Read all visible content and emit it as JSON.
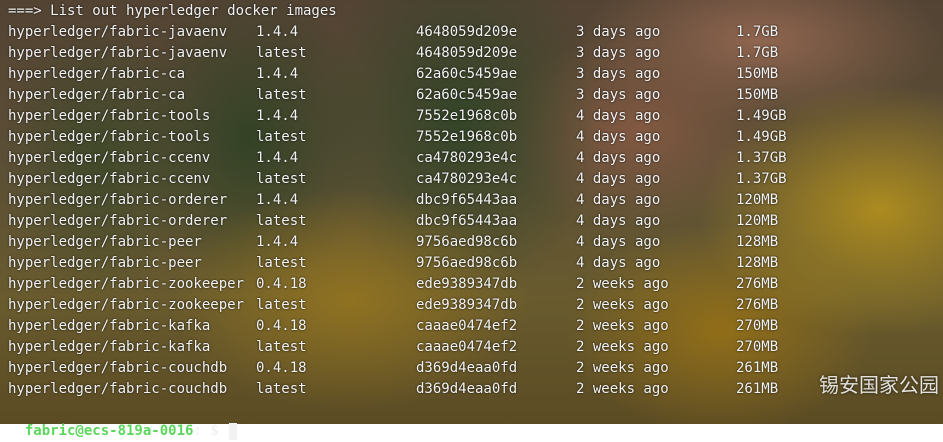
{
  "colors": {
    "prompt_accent": "#5bd75b",
    "text": "#f2f2f2"
  },
  "terminal": {
    "header": "===> List out hyperledger docker images",
    "rows": [
      {
        "repo": "hyperledger/fabric-javaenv",
        "tag": "1.4.4",
        "id": "4648059d209e",
        "created": "3 days ago",
        "size": "1.7GB"
      },
      {
        "repo": "hyperledger/fabric-javaenv",
        "tag": "latest",
        "id": "4648059d209e",
        "created": "3 days ago",
        "size": "1.7GB"
      },
      {
        "repo": "hyperledger/fabric-ca",
        "tag": "1.4.4",
        "id": "62a60c5459ae",
        "created": "3 days ago",
        "size": "150MB"
      },
      {
        "repo": "hyperledger/fabric-ca",
        "tag": "latest",
        "id": "62a60c5459ae",
        "created": "3 days ago",
        "size": "150MB"
      },
      {
        "repo": "hyperledger/fabric-tools",
        "tag": "1.4.4",
        "id": "7552e1968c0b",
        "created": "4 days ago",
        "size": "1.49GB"
      },
      {
        "repo": "hyperledger/fabric-tools",
        "tag": "latest",
        "id": "7552e1968c0b",
        "created": "4 days ago",
        "size": "1.49GB"
      },
      {
        "repo": "hyperledger/fabric-ccenv",
        "tag": "1.4.4",
        "id": "ca4780293e4c",
        "created": "4 days ago",
        "size": "1.37GB"
      },
      {
        "repo": "hyperledger/fabric-ccenv",
        "tag": "latest",
        "id": "ca4780293e4c",
        "created": "4 days ago",
        "size": "1.37GB"
      },
      {
        "repo": "hyperledger/fabric-orderer",
        "tag": "1.4.4",
        "id": "dbc9f65443aa",
        "created": "4 days ago",
        "size": "120MB"
      },
      {
        "repo": "hyperledger/fabric-orderer",
        "tag": "latest",
        "id": "dbc9f65443aa",
        "created": "4 days ago",
        "size": "120MB"
      },
      {
        "repo": "hyperledger/fabric-peer",
        "tag": "1.4.4",
        "id": "9756aed98c6b",
        "created": "4 days ago",
        "size": "128MB"
      },
      {
        "repo": "hyperledger/fabric-peer",
        "tag": "latest",
        "id": "9756aed98c6b",
        "created": "4 days ago",
        "size": "128MB"
      },
      {
        "repo": "hyperledger/fabric-zookeeper",
        "tag": "0.4.18",
        "id": "ede9389347db",
        "created": "2 weeks ago",
        "size": "276MB"
      },
      {
        "repo": "hyperledger/fabric-zookeeper",
        "tag": "latest",
        "id": "ede9389347db",
        "created": "2 weeks ago",
        "size": "276MB"
      },
      {
        "repo": "hyperledger/fabric-kafka",
        "tag": "0.4.18",
        "id": "caaae0474ef2",
        "created": "2 weeks ago",
        "size": "270MB"
      },
      {
        "repo": "hyperledger/fabric-kafka",
        "tag": "latest",
        "id": "caaae0474ef2",
        "created": "2 weeks ago",
        "size": "270MB"
      },
      {
        "repo": "hyperledger/fabric-couchdb",
        "tag": "0.4.18",
        "id": "d369d4eaa0fd",
        "created": "2 weeks ago",
        "size": "261MB"
      },
      {
        "repo": "hyperledger/fabric-couchdb",
        "tag": "latest",
        "id": "d369d4eaa0fd",
        "created": "2 weeks ago",
        "size": "261MB"
      }
    ],
    "prompt": {
      "user_host": "fabric@ecs-819a-0016",
      "path": ": ",
      "symbol": "$ "
    }
  },
  "watermark": "锡安国家公园"
}
